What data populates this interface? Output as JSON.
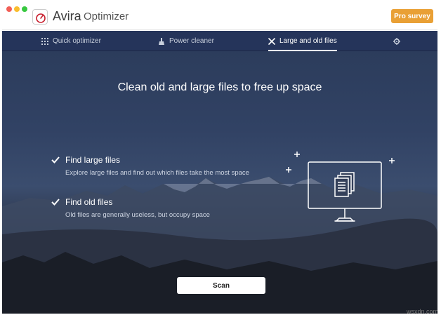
{
  "window": {
    "app_name": "Avira",
    "app_subtitle": "Optimizer",
    "pro_survey_label": "Pro survey"
  },
  "nav": {
    "tabs": [
      {
        "label": "Quick optimizer",
        "icon": "grid-icon",
        "active": false
      },
      {
        "label": "Power cleaner",
        "icon": "broom-icon",
        "active": false
      },
      {
        "label": "Large and old files",
        "icon": "tools-icon",
        "active": true
      }
    ],
    "settings_icon": "gear-icon"
  },
  "main": {
    "headline": "Clean old and large files to free up space",
    "features": [
      {
        "title": "Find large files",
        "description": "Explore large files and find out which files take the most space"
      },
      {
        "title": "Find old files",
        "description": "Old files are generally useless, but occupy space"
      }
    ],
    "scan_label": "Scan"
  },
  "watermark": "wsxdn.com",
  "colors": {
    "accent": "#e9a035",
    "nav_bg": "#25345a",
    "bg_top": "#2b3b5a",
    "bg_bottom": "#1c2029",
    "white": "#ffffff"
  }
}
